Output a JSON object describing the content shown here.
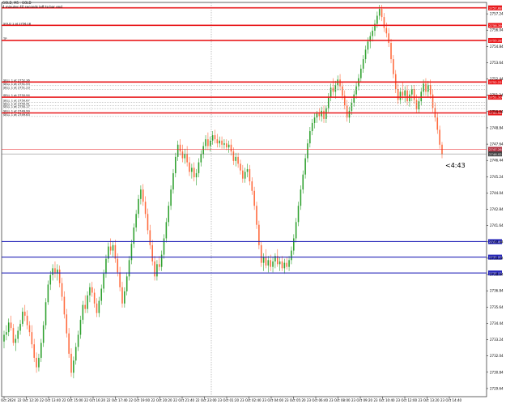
{
  "header": {
    "symbol_line": "GOLD, M5 : GOLD",
    "timer_line": "4 minutes 40 seconds left to bar end"
  },
  "countdown": "<4:43",
  "colors": {
    "background": "#ffffff",
    "grid": "#c8c8c8",
    "bull_candle": "#2fa12f",
    "bear_candle": "#ff6a3d",
    "resistance_line": "#e8191c",
    "support_line": "#2424b8",
    "order_line": "#9a9a9a",
    "current_bid": "#b03040"
  },
  "chart_data": {
    "type": "candlestick",
    "symbol": "GOLD",
    "timeframe": "M5",
    "ylim": [
      2729.04,
      2758.08
    ],
    "y_ticks": [
      2757.24,
      2756.04,
      2754.84,
      2753.64,
      2752.44,
      2751.24,
      2750.04,
      2748.84,
      2747.64,
      2746.44,
      2745.24,
      2744.04,
      2742.84,
      2741.64,
      2740.44,
      2739.24,
      2738.04,
      2736.84,
      2735.64,
      2734.44,
      2733.24,
      2732.04,
      2730.84,
      2729.64
    ],
    "x_ticks": [
      "22 Oct 2024",
      "22 Oct 12:20",
      "22 Oct 13:40",
      "22 Oct 15:00",
      "22 Oct 16:20",
      "22 Oct 17:40",
      "22 Oct 19:00",
      "22 Oct 20:20",
      "22 Oct 21:40",
      "22 Oct 23:00",
      "23 Oct 01:20",
      "23 Oct 02:40",
      "23 Oct 04:00",
      "23 Oct 05:20",
      "23 Oct 06:40",
      "23 Oct 08:00",
      "23 Oct 09:20",
      "23 Oct 10:40",
      "23 Oct 12:00",
      "23 Oct 13:20",
      "23 Oct 14:40"
    ],
    "horizontal_lines": [
      {
        "price": 2757.68,
        "kind": "resistance",
        "label": "",
        "price_tag": "2757.68"
      },
      {
        "price": 2756.39,
        "kind": "resistance",
        "label": "SOLD 1 at 2756.18",
        "price_tag": "2756.39"
      },
      {
        "price": 2755.28,
        "kind": "resistance",
        "label": "TP",
        "price_tag": "2755.28"
      },
      {
        "price": 2752.22,
        "kind": "resistance",
        "label": "SELL 1 at 2752.36",
        "price_tag": "2752.22"
      },
      {
        "price": 2751.95,
        "kind": "order",
        "label": "SELL 1 at 2751.53",
        "price_tag": ""
      },
      {
        "price": 2751.68,
        "kind": "order",
        "label": "SELL 1 at 2751.23",
        "price_tag": ""
      },
      {
        "price": 2751.1,
        "kind": "resistance",
        "label": "SELL 1 at 2750.94",
        "price_tag": "2751.10"
      },
      {
        "price": 2750.72,
        "kind": "order",
        "label": "SELL 1 at 2750.67",
        "price_tag": ""
      },
      {
        "price": 2750.48,
        "kind": "order",
        "label": "SELL 1 at 2750.41",
        "price_tag": ""
      },
      {
        "price": 2750.26,
        "kind": "order",
        "label": "SELL 1 at 2750.17",
        "price_tag": ""
      },
      {
        "price": 2749.94,
        "kind": "resistance",
        "label": "SELL 1 at 2749.99",
        "price_tag": "2749.94"
      },
      {
        "price": 2749.68,
        "kind": "order",
        "label": "SELL 1 at 2749.63",
        "price_tag": ""
      },
      {
        "price": 2747.26,
        "kind": "bid",
        "label": "",
        "price_tag": "2747.26"
      },
      {
        "price": 2746.92,
        "kind": "ask",
        "label": "",
        "price_tag": "2746.92"
      },
      {
        "price": 2740.46,
        "kind": "support",
        "label": "",
        "price_tag": "2740.46"
      },
      {
        "price": 2739.32,
        "kind": "support",
        "label": "",
        "price_tag": "2739.32"
      },
      {
        "price": 2738.15,
        "kind": "support",
        "label": "",
        "price_tag": "2738.15"
      }
    ],
    "candles": [
      [
        2733.1,
        2733.9,
        2732.6,
        2733.6
      ],
      [
        2733.6,
        2734.3,
        2733.2,
        2733.8
      ],
      [
        2733.8,
        2734.8,
        2733.5,
        2734.5
      ],
      [
        2734.5,
        2735.0,
        2733.9,
        2734.1
      ],
      [
        2734.1,
        2734.4,
        2732.8,
        2733.0
      ],
      [
        2733.0,
        2733.6,
        2732.4,
        2733.3
      ],
      [
        2733.3,
        2734.2,
        2733.0,
        2733.9
      ],
      [
        2733.9,
        2734.7,
        2733.6,
        2734.4
      ],
      [
        2734.4,
        2735.6,
        2734.2,
        2735.3
      ],
      [
        2735.3,
        2735.8,
        2734.6,
        2735.0
      ],
      [
        2735.0,
        2735.4,
        2734.0,
        2734.3
      ],
      [
        2734.3,
        2734.6,
        2733.5,
        2733.8
      ],
      [
        2733.8,
        2734.3,
        2732.6,
        2732.9
      ],
      [
        2732.9,
        2733.3,
        2731.6,
        2731.9
      ],
      [
        2731.9,
        2732.3,
        2730.8,
        2731.2
      ],
      [
        2731.2,
        2732.2,
        2730.9,
        2731.9
      ],
      [
        2731.9,
        2733.3,
        2731.6,
        2733.0
      ],
      [
        2733.0,
        2734.6,
        2732.7,
        2734.3
      ],
      [
        2734.3,
        2736.3,
        2734.0,
        2736.0
      ],
      [
        2736.0,
        2737.6,
        2735.8,
        2737.3
      ],
      [
        2737.3,
        2738.3,
        2736.9,
        2738.0
      ],
      [
        2738.0,
        2738.8,
        2737.6,
        2738.5
      ],
      [
        2738.5,
        2739.0,
        2737.8,
        2738.1
      ],
      [
        2738.1,
        2738.8,
        2737.6,
        2738.4
      ],
      [
        2738.4,
        2738.7,
        2737.1,
        2737.4
      ],
      [
        2737.4,
        2737.8,
        2736.1,
        2736.4
      ],
      [
        2736.4,
        2736.8,
        2734.8,
        2735.1
      ],
      [
        2735.1,
        2735.5,
        2733.4,
        2733.7
      ],
      [
        2733.7,
        2734.1,
        2731.9,
        2732.2
      ],
      [
        2732.2,
        2732.6,
        2730.5,
        2730.8
      ],
      [
        2730.8,
        2732.0,
        2730.4,
        2731.7
      ],
      [
        2731.7,
        2733.0,
        2731.4,
        2732.7
      ],
      [
        2732.7,
        2733.9,
        2732.4,
        2733.6
      ],
      [
        2733.6,
        2735.0,
        2733.3,
        2734.7
      ],
      [
        2734.7,
        2736.1,
        2734.4,
        2735.8
      ],
      [
        2735.8,
        2736.5,
        2735.2,
        2735.5
      ],
      [
        2735.5,
        2736.8,
        2735.2,
        2736.5
      ],
      [
        2736.5,
        2737.4,
        2736.0,
        2737.1
      ],
      [
        2737.1,
        2737.5,
        2736.4,
        2736.7
      ],
      [
        2736.7,
        2737.0,
        2735.6,
        2735.9
      ],
      [
        2735.9,
        2736.3,
        2734.9,
        2735.2
      ],
      [
        2735.2,
        2736.4,
        2734.9,
        2736.1
      ],
      [
        2736.1,
        2737.3,
        2735.8,
        2737.0
      ],
      [
        2737.0,
        2738.4,
        2736.7,
        2738.1
      ],
      [
        2738.1,
        2739.5,
        2737.8,
        2739.2
      ],
      [
        2739.2,
        2740.4,
        2738.9,
        2740.1
      ],
      [
        2740.1,
        2740.7,
        2739.5,
        2739.8
      ],
      [
        2739.8,
        2740.5,
        2739.3,
        2740.2
      ],
      [
        2740.2,
        2740.6,
        2738.9,
        2739.2
      ],
      [
        2739.2,
        2739.6,
        2737.9,
        2738.2
      ],
      [
        2738.2,
        2738.6,
        2736.8,
        2737.1
      ],
      [
        2737.1,
        2737.5,
        2735.6,
        2735.9
      ],
      [
        2735.9,
        2737.1,
        2735.6,
        2736.8
      ],
      [
        2736.8,
        2738.2,
        2736.5,
        2737.9
      ],
      [
        2737.9,
        2739.4,
        2737.6,
        2739.1
      ],
      [
        2739.1,
        2740.6,
        2738.8,
        2740.3
      ],
      [
        2740.3,
        2741.8,
        2740.0,
        2741.5
      ],
      [
        2741.5,
        2742.8,
        2741.2,
        2742.5
      ],
      [
        2742.5,
        2743.9,
        2742.2,
        2743.6
      ],
      [
        2743.6,
        2744.6,
        2743.2,
        2744.3
      ],
      [
        2744.3,
        2744.7,
        2743.1,
        2743.4
      ],
      [
        2743.4,
        2743.8,
        2742.2,
        2742.5
      ],
      [
        2742.5,
        2742.9,
        2741.0,
        2741.3
      ],
      [
        2741.3,
        2741.7,
        2739.9,
        2740.2
      ],
      [
        2740.2,
        2740.6,
        2738.7,
        2739.0
      ],
      [
        2739.0,
        2739.4,
        2737.6,
        2737.9
      ],
      [
        2737.9,
        2739.1,
        2737.6,
        2738.8
      ],
      [
        2738.8,
        2739.4,
        2738.3,
        2738.6
      ],
      [
        2738.6,
        2739.8,
        2738.3,
        2739.5
      ],
      [
        2739.5,
        2741.0,
        2739.2,
        2740.7
      ],
      [
        2740.7,
        2742.2,
        2740.4,
        2741.9
      ],
      [
        2741.9,
        2743.4,
        2741.6,
        2743.1
      ],
      [
        2743.1,
        2744.6,
        2742.8,
        2744.3
      ],
      [
        2744.3,
        2745.8,
        2744.0,
        2745.5
      ],
      [
        2745.5,
        2747.0,
        2745.2,
        2746.7
      ],
      [
        2746.7,
        2747.9,
        2746.4,
        2747.6
      ],
      [
        2747.6,
        2748.0,
        2746.8,
        2747.1
      ],
      [
        2747.1,
        2747.6,
        2746.3,
        2746.6
      ],
      [
        2746.6,
        2747.3,
        2746.2,
        2746.9
      ],
      [
        2746.9,
        2747.5,
        2746.0,
        2746.3
      ],
      [
        2746.3,
        2746.7,
        2745.3,
        2745.6
      ],
      [
        2745.6,
        2746.2,
        2745.1,
        2745.9
      ],
      [
        2745.9,
        2746.3,
        2744.9,
        2745.2
      ],
      [
        2745.2,
        2745.8,
        2744.6,
        2745.5
      ],
      [
        2745.5,
        2746.6,
        2745.2,
        2746.3
      ],
      [
        2746.3,
        2747.2,
        2746.0,
        2746.9
      ],
      [
        2746.9,
        2747.8,
        2746.6,
        2747.5
      ],
      [
        2747.5,
        2748.3,
        2747.2,
        2748.0
      ],
      [
        2748.0,
        2748.5,
        2747.2,
        2747.5
      ],
      [
        2747.5,
        2748.2,
        2747.1,
        2747.9
      ],
      [
        2747.9,
        2748.6,
        2747.6,
        2748.3
      ],
      [
        2748.3,
        2748.7,
        2747.7,
        2748.0
      ],
      [
        2748.0,
        2748.4,
        2747.4,
        2747.7
      ],
      [
        2747.7,
        2748.2,
        2747.4,
        2747.9
      ],
      [
        2747.9,
        2748.2,
        2747.3,
        2747.6
      ],
      [
        2747.6,
        2748.0,
        2747.3,
        2747.7
      ],
      [
        2747.7,
        2748.0,
        2747.2,
        2747.4
      ],
      [
        2747.4,
        2747.9,
        2747.0,
        2747.6
      ],
      [
        2747.6,
        2748.0,
        2746.8,
        2747.1
      ],
      [
        2747.1,
        2747.4,
        2746.1,
        2746.4
      ],
      [
        2746.4,
        2747.0,
        2746.0,
        2746.7
      ],
      [
        2746.7,
        2747.0,
        2745.9,
        2746.2
      ],
      [
        2746.2,
        2746.5,
        2745.4,
        2745.7
      ],
      [
        2745.7,
        2746.1,
        2744.8,
        2745.1
      ],
      [
        2745.1,
        2745.9,
        2744.8,
        2745.6
      ],
      [
        2745.6,
        2746.2,
        2745.2,
        2745.8
      ],
      [
        2745.8,
        2746.1,
        2744.6,
        2744.9
      ],
      [
        2744.9,
        2745.2,
        2743.9,
        2744.2
      ],
      [
        2744.2,
        2744.5,
        2742.8,
        2743.1
      ],
      [
        2743.1,
        2743.4,
        2741.4,
        2741.7
      ],
      [
        2741.7,
        2742.0,
        2739.9,
        2740.2
      ],
      [
        2740.2,
        2740.5,
        2738.6,
        2738.9
      ],
      [
        2738.9,
        2739.6,
        2738.3,
        2739.3
      ],
      [
        2739.3,
        2739.9,
        2738.5,
        2738.7
      ],
      [
        2738.7,
        2739.4,
        2738.2,
        2739.1
      ],
      [
        2739.1,
        2739.5,
        2738.3,
        2738.6
      ],
      [
        2738.6,
        2739.3,
        2738.2,
        2739.0
      ],
      [
        2739.0,
        2739.6,
        2738.5,
        2739.4
      ],
      [
        2739.4,
        2739.9,
        2738.6,
        2738.8
      ],
      [
        2738.8,
        2739.3,
        2738.3,
        2739.0
      ],
      [
        2739.0,
        2739.4,
        2738.3,
        2738.5
      ],
      [
        2738.5,
        2739.2,
        2738.1,
        2738.9
      ],
      [
        2738.9,
        2739.3,
        2738.4,
        2738.6
      ],
      [
        2738.6,
        2739.4,
        2738.3,
        2739.1
      ],
      [
        2739.1,
        2740.1,
        2738.8,
        2739.8
      ],
      [
        2739.8,
        2741.0,
        2739.5,
        2740.7
      ],
      [
        2740.7,
        2742.2,
        2740.4,
        2741.9
      ],
      [
        2741.9,
        2743.4,
        2741.6,
        2743.1
      ],
      [
        2743.1,
        2744.6,
        2742.8,
        2744.3
      ],
      [
        2744.3,
        2745.7,
        2744.0,
        2745.4
      ],
      [
        2745.4,
        2746.9,
        2745.1,
        2746.6
      ],
      [
        2746.6,
        2748.0,
        2746.3,
        2747.7
      ],
      [
        2747.7,
        2748.9,
        2747.4,
        2748.6
      ],
      [
        2748.6,
        2749.5,
        2748.3,
        2749.2
      ],
      [
        2749.2,
        2749.9,
        2748.8,
        2749.6
      ],
      [
        2749.6,
        2750.1,
        2749.2,
        2749.9
      ],
      [
        2749.9,
        2750.3,
        2749.4,
        2749.7
      ],
      [
        2749.7,
        2750.4,
        2749.3,
        2750.1
      ],
      [
        2750.1,
        2750.5,
        2749.2,
        2749.5
      ],
      [
        2749.5,
        2750.5,
        2749.2,
        2750.3
      ],
      [
        2750.3,
        2751.4,
        2750.0,
        2751.1
      ],
      [
        2751.1,
        2752.1,
        2750.8,
        2751.8
      ],
      [
        2751.8,
        2752.5,
        2751.2,
        2751.5
      ],
      [
        2751.5,
        2752.3,
        2751.0,
        2752.0
      ],
      [
        2752.0,
        2752.7,
        2751.6,
        2752.4
      ],
      [
        2752.4,
        2752.8,
        2751.6,
        2751.9
      ],
      [
        2751.9,
        2752.2,
        2750.9,
        2751.2
      ],
      [
        2751.2,
        2751.6,
        2750.2,
        2750.5
      ],
      [
        2750.5,
        2750.9,
        2749.3,
        2749.6
      ],
      [
        2749.6,
        2750.4,
        2749.2,
        2750.1
      ],
      [
        2750.1,
        2751.0,
        2749.8,
        2750.7
      ],
      [
        2750.7,
        2751.6,
        2750.4,
        2751.3
      ],
      [
        2751.3,
        2752.2,
        2751.0,
        2751.9
      ],
      [
        2751.9,
        2752.8,
        2751.6,
        2752.5
      ],
      [
        2752.5,
        2753.5,
        2752.2,
        2753.2
      ],
      [
        2753.2,
        2754.2,
        2752.9,
        2753.9
      ],
      [
        2753.9,
        2754.9,
        2753.6,
        2754.6
      ],
      [
        2754.6,
        2755.5,
        2754.3,
        2755.2
      ],
      [
        2755.2,
        2755.9,
        2754.7,
        2755.6
      ],
      [
        2755.6,
        2756.3,
        2755.2,
        2756.0
      ],
      [
        2756.0,
        2756.8,
        2755.6,
        2756.5
      ],
      [
        2756.5,
        2757.4,
        2756.2,
        2757.1
      ],
      [
        2757.1,
        2757.9,
        2756.8,
        2757.6
      ],
      [
        2757.6,
        2757.9,
        2756.7,
        2757.0
      ],
      [
        2757.0,
        2757.3,
        2755.9,
        2756.2
      ],
      [
        2756.2,
        2756.6,
        2755.5,
        2755.8
      ],
      [
        2755.8,
        2756.2,
        2754.8,
        2755.1
      ],
      [
        2755.1,
        2755.4,
        2753.6,
        2753.9
      ],
      [
        2753.9,
        2754.2,
        2752.5,
        2752.8
      ],
      [
        2752.8,
        2753.1,
        2751.4,
        2751.7
      ],
      [
        2751.7,
        2752.1,
        2750.6,
        2750.9
      ],
      [
        2750.9,
        2751.8,
        2750.6,
        2751.5
      ],
      [
        2751.5,
        2752.2,
        2750.9,
        2751.2
      ],
      [
        2751.2,
        2751.9,
        2750.7,
        2751.6
      ],
      [
        2751.6,
        2752.0,
        2750.5,
        2750.8
      ],
      [
        2750.8,
        2751.6,
        2750.4,
        2751.3
      ],
      [
        2751.3,
        2752.0,
        2750.8,
        2751.7
      ],
      [
        2751.7,
        2752.0,
        2750.6,
        2750.9
      ],
      [
        2750.9,
        2751.3,
        2749.9,
        2750.2
      ],
      [
        2750.2,
        2751.1,
        2749.9,
        2750.8
      ],
      [
        2750.8,
        2751.8,
        2750.5,
        2751.5
      ],
      [
        2751.5,
        2752.4,
        2751.2,
        2752.1
      ],
      [
        2752.1,
        2752.5,
        2751.2,
        2751.5
      ],
      [
        2751.5,
        2752.3,
        2751.1,
        2752.0
      ],
      [
        2752.0,
        2752.4,
        2751.0,
        2751.3
      ],
      [
        2751.3,
        2751.7,
        2750.0,
        2750.3
      ],
      [
        2750.3,
        2750.7,
        2749.3,
        2749.6
      ],
      [
        2749.6,
        2750.0,
        2748.4,
        2748.7
      ],
      [
        2748.7,
        2749.0,
        2747.3,
        2747.6
      ],
      [
        2747.6,
        2747.8,
        2746.6,
        2746.9
      ]
    ]
  }
}
